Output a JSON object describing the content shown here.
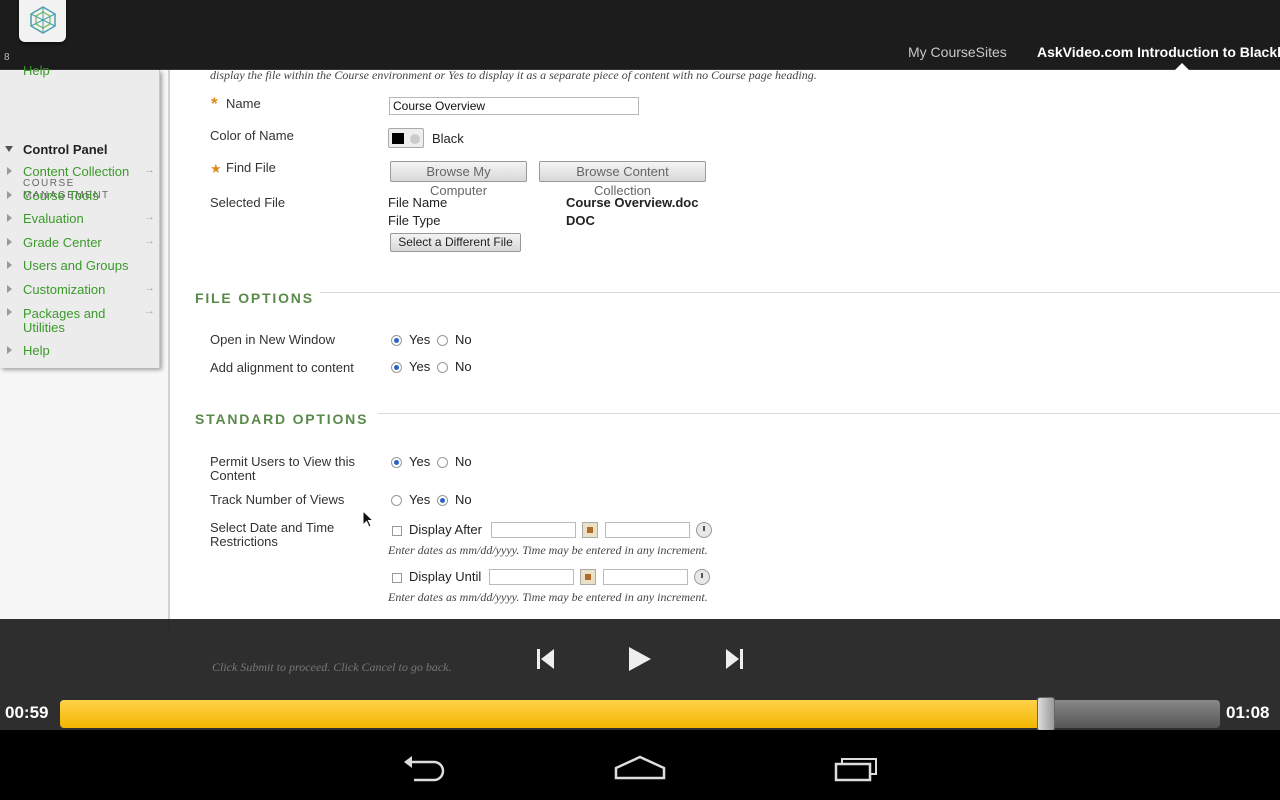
{
  "header": {
    "nav_my_coursesites": "My CourseSites",
    "nav_course_title": "AskVideo.com Introduction to Blackb",
    "small_glyph": "8"
  },
  "sidebar": {
    "top_link": "Help",
    "section_label": "COURSE MANAGEMENT",
    "control_panel": "Control Panel",
    "items": [
      {
        "label": "Content Collection"
      },
      {
        "label": "Course Tools"
      },
      {
        "label": "Evaluation"
      },
      {
        "label": "Grade Center"
      },
      {
        "label": "Users and Groups"
      },
      {
        "label": "Customization"
      },
      {
        "label": "Packages and Utilities"
      },
      {
        "label": "Help"
      }
    ]
  },
  "content": {
    "top_cut_text": "display the file within the Course environment or Yes to display it as a separate piece of content with no Course page heading.",
    "name_label": "Name",
    "name_value": "Course Overview",
    "color_label": "Color of Name",
    "color_value": "Black",
    "find_file_label": "Find File",
    "browse_computer": "Browse My Computer",
    "browse_collection": "Browse Content Collection",
    "selected_file_label": "Selected File",
    "file_name_label": "File Name",
    "file_name_value": "Course Overview.doc",
    "file_type_label": "File Type",
    "file_type_value": "DOC",
    "select_different": "Select a Different File",
    "file_options_title": "FILE OPTIONS",
    "open_new_window_label": "Open in New Window",
    "add_alignment_label": "Add alignment to content",
    "standard_options_title": "STANDARD OPTIONS",
    "permit_users_label": "Permit Users to View this Content",
    "track_views_label": "Track Number of Views",
    "date_restrictions_label": "Select Date and Time Restrictions",
    "display_after": "Display After",
    "display_until": "Display Until",
    "date_hint": "Enter dates as mm/dd/yyyy. Time may be entered in any increment.",
    "yes": "Yes",
    "no": "No",
    "submit_hint": "Click Submit to proceed. Click Cancel to go back."
  },
  "player": {
    "elapsed": "00:59",
    "total": "01:08",
    "progress": 0.85
  },
  "colors": {
    "accent_green": "#3a9a2a",
    "progress_yellow": "#f2b600"
  }
}
